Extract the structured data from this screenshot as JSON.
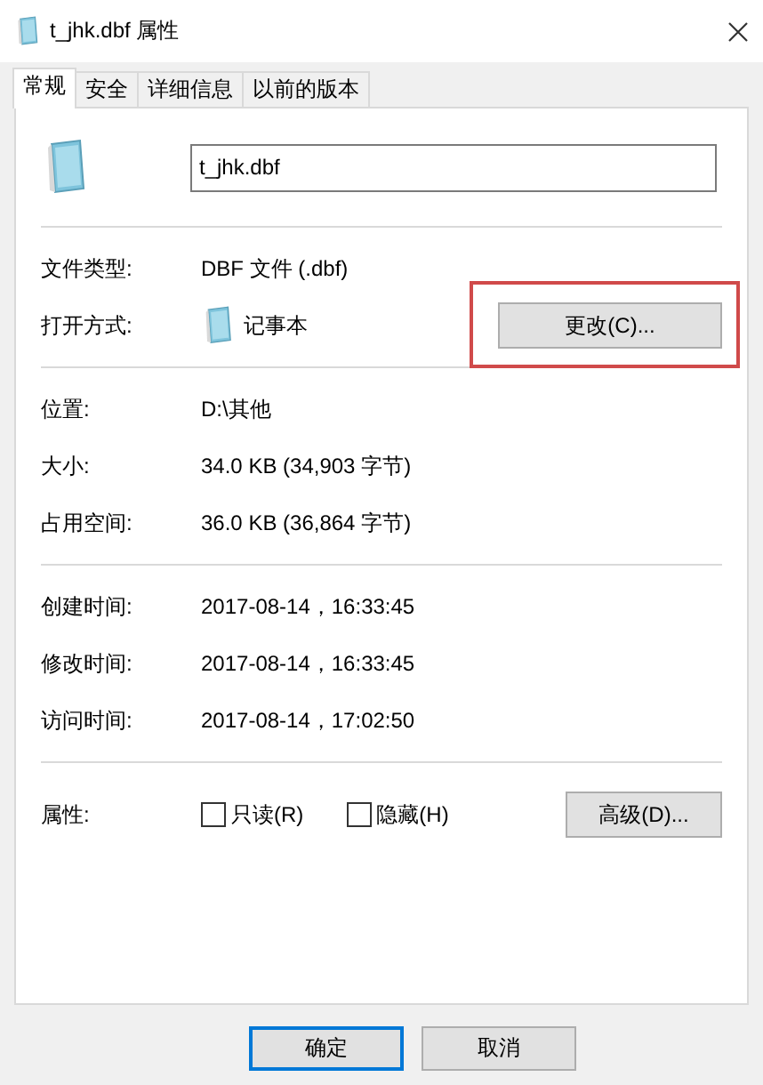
{
  "window": {
    "title": "t_jhk.dbf 属性"
  },
  "tabs": [
    {
      "label": "常规",
      "selected": true
    },
    {
      "label": "安全",
      "selected": false
    },
    {
      "label": "详细信息",
      "selected": false
    },
    {
      "label": "以前的版本",
      "selected": false
    }
  ],
  "file_name": "t_jhk.dbf",
  "sections": [
    {
      "rows": [
        {
          "kind": "text",
          "label": "文件类型:",
          "value": "DBF 文件 (.dbf)"
        },
        {
          "kind": "app",
          "label": "打开方式:",
          "value": "记事本",
          "button": "更改(C)...",
          "highlighted": true
        }
      ]
    },
    {
      "rows": [
        {
          "kind": "text",
          "label": "位置:",
          "value": "D:\\其他"
        },
        {
          "kind": "text",
          "label": "大小:",
          "value": "34.0 KB (34,903 字节)"
        },
        {
          "kind": "text",
          "label": "占用空间:",
          "value": "36.0 KB (36,864 字节)"
        }
      ]
    },
    {
      "rows": [
        {
          "kind": "text",
          "label": "创建时间:",
          "value": "2017-08-14，16:33:45"
        },
        {
          "kind": "text",
          "label": "修改时间:",
          "value": "2017-08-14，16:33:45"
        },
        {
          "kind": "text",
          "label": "访问时间:",
          "value": "2017-08-14，17:02:50"
        }
      ]
    }
  ],
  "attributes": {
    "label": "属性:",
    "checkboxes": [
      {
        "label": "只读(R)",
        "checked": false
      },
      {
        "label": "隐藏(H)",
        "checked": false
      }
    ],
    "button": "高级(D)..."
  },
  "buttons": [
    {
      "label": "确定",
      "default": true
    },
    {
      "label": "取消",
      "default": false
    }
  ]
}
